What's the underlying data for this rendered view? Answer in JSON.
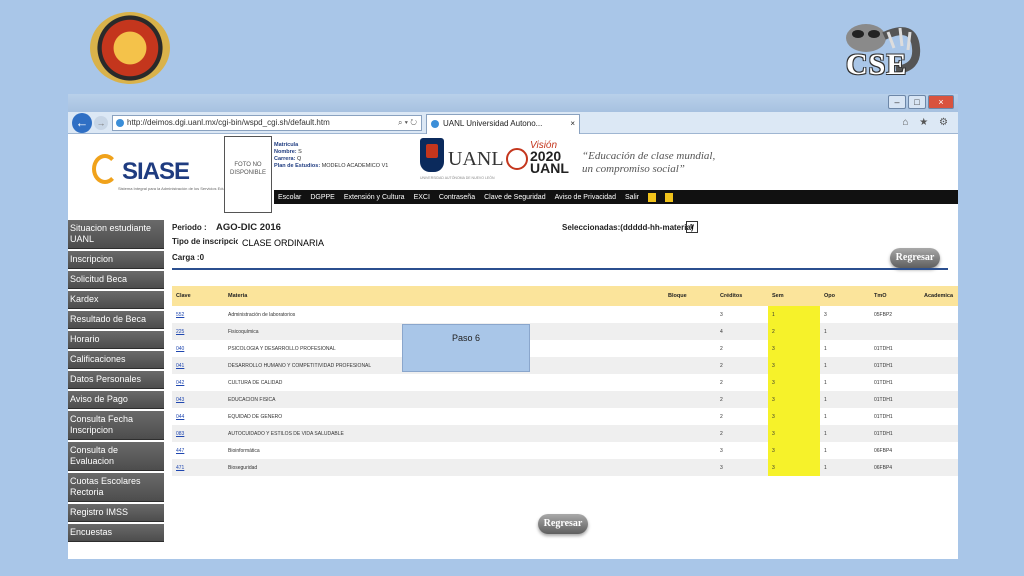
{
  "slide": {
    "right_logo_text": "CSE",
    "step_label": "Paso 6"
  },
  "browser": {
    "url": "http://deimos.dgi.uanl.mx/cgi-bin/wspd_cgi.sh/default.htm",
    "tab_title": "UANL Universidad Autono...",
    "tab_close": "×",
    "addr_tools": "⌕ ▾ ↻",
    "window_buttons": {
      "minimize": "–",
      "maximize": "□",
      "close": "×"
    },
    "right_tools": "⌂ ★ ⚙"
  },
  "header": {
    "logo_text": "SIASE",
    "logo_sub": "Sistema Integral para la Administración de los Servicios Educativos",
    "photo_text": "FOTO NO DISPONIBLE",
    "student": {
      "matricula_label": "Matrícula",
      "nombre_label": "Nombre:",
      "nombre_value": "S",
      "carrera_label": "Carrera:",
      "carrera_value": "Q",
      "plan_label": "Plan de Estudios:",
      "plan_value": "MODELO ACADEMICO V1"
    },
    "uanl_text": "UANL",
    "uanl_sub": "UNIVERSIDAD AUTÓNOMA DE NUEVO LEÓN",
    "vision_word": "Visión",
    "vision_year": "2020 UANL",
    "slogan_line1": "“Educación de clase mundial,",
    "slogan_line2": "un compromiso social”"
  },
  "menu": [
    "Escolar",
    "DGPPE",
    "Extensión y Cultura",
    "EXCI",
    "Contraseña",
    "Clave de Seguridad",
    "Aviso de Privacidad",
    "Salir"
  ],
  "sidebar": [
    "Situacion estudiante UANL",
    "Inscripcion",
    "Solicitud Beca",
    "Kardex",
    "Resultado de Beca",
    "Horario",
    "Calificaciones",
    "Datos Personales",
    "Aviso de Pago",
    "Consulta Fecha Inscripcion",
    "Consulta de Evaluacion",
    "Cuotas Escolares Rectoria",
    "Registro IMSS",
    "Encuestas"
  ],
  "info": {
    "periodo_label": "Periodo :",
    "periodo_value": "AGO-DIC 2016",
    "tipo_label": "Tipo de inscripcion",
    "tipo_value": "CLASE ORDINARIA",
    "carga_label": "Carga :0",
    "seleccionadas_label": "Seleccionadas:(ddddd-hh-materia)",
    "dropdown_arrow": "∨",
    "regresar": "Regresar"
  },
  "table": {
    "headers": [
      "Clave",
      "Materia",
      "Bloque",
      "Créditos",
      "Sem",
      "Opo",
      "TmO",
      "Academica"
    ],
    "rows": [
      [
        "552",
        "Administración de laboratorios",
        "",
        "3",
        "1",
        "3",
        "05FBP2",
        ""
      ],
      [
        "225",
        "Fisicoquímica",
        "",
        "4",
        "2",
        "1",
        "",
        ""
      ],
      [
        "040",
        "PSICOLOGIA Y DESARROLLO PROFESIONAL",
        "",
        "2",
        "3",
        "1",
        "01TDH1",
        ""
      ],
      [
        "041",
        "DESARROLLO HUMANO Y COMPETITIVIDAD PROFESIONAL",
        "",
        "2",
        "3",
        "1",
        "01TDH1",
        ""
      ],
      [
        "042",
        "CULTURA DE CALIDAD",
        "",
        "2",
        "3",
        "1",
        "01TDH1",
        ""
      ],
      [
        "043",
        "EDUCACION FISICA",
        "",
        "2",
        "3",
        "1",
        "01TDH1",
        ""
      ],
      [
        "044",
        "EQUIDAD DE GENERO",
        "",
        "2",
        "3",
        "1",
        "01TDH1",
        ""
      ],
      [
        "083",
        "AUTOCUIDADO Y ESTILOS DE VIDA SALUDABLE",
        "",
        "2",
        "3",
        "1",
        "01TDH1",
        ""
      ],
      [
        "447",
        "Bioinformática",
        "",
        "3",
        "3",
        "1",
        "06FBP4",
        ""
      ],
      [
        "471",
        "Bioseguridad",
        "",
        "3",
        "3",
        "1",
        "06FBP4",
        ""
      ]
    ]
  },
  "colors": {
    "slide_bg": "#a9c6e8",
    "table_header": "#fbe49b",
    "sem_highlight": "#f6f22a",
    "sidebar_bg": "#5a5a5a",
    "menubar_bg": "#111111",
    "link": "#1f47b0"
  }
}
